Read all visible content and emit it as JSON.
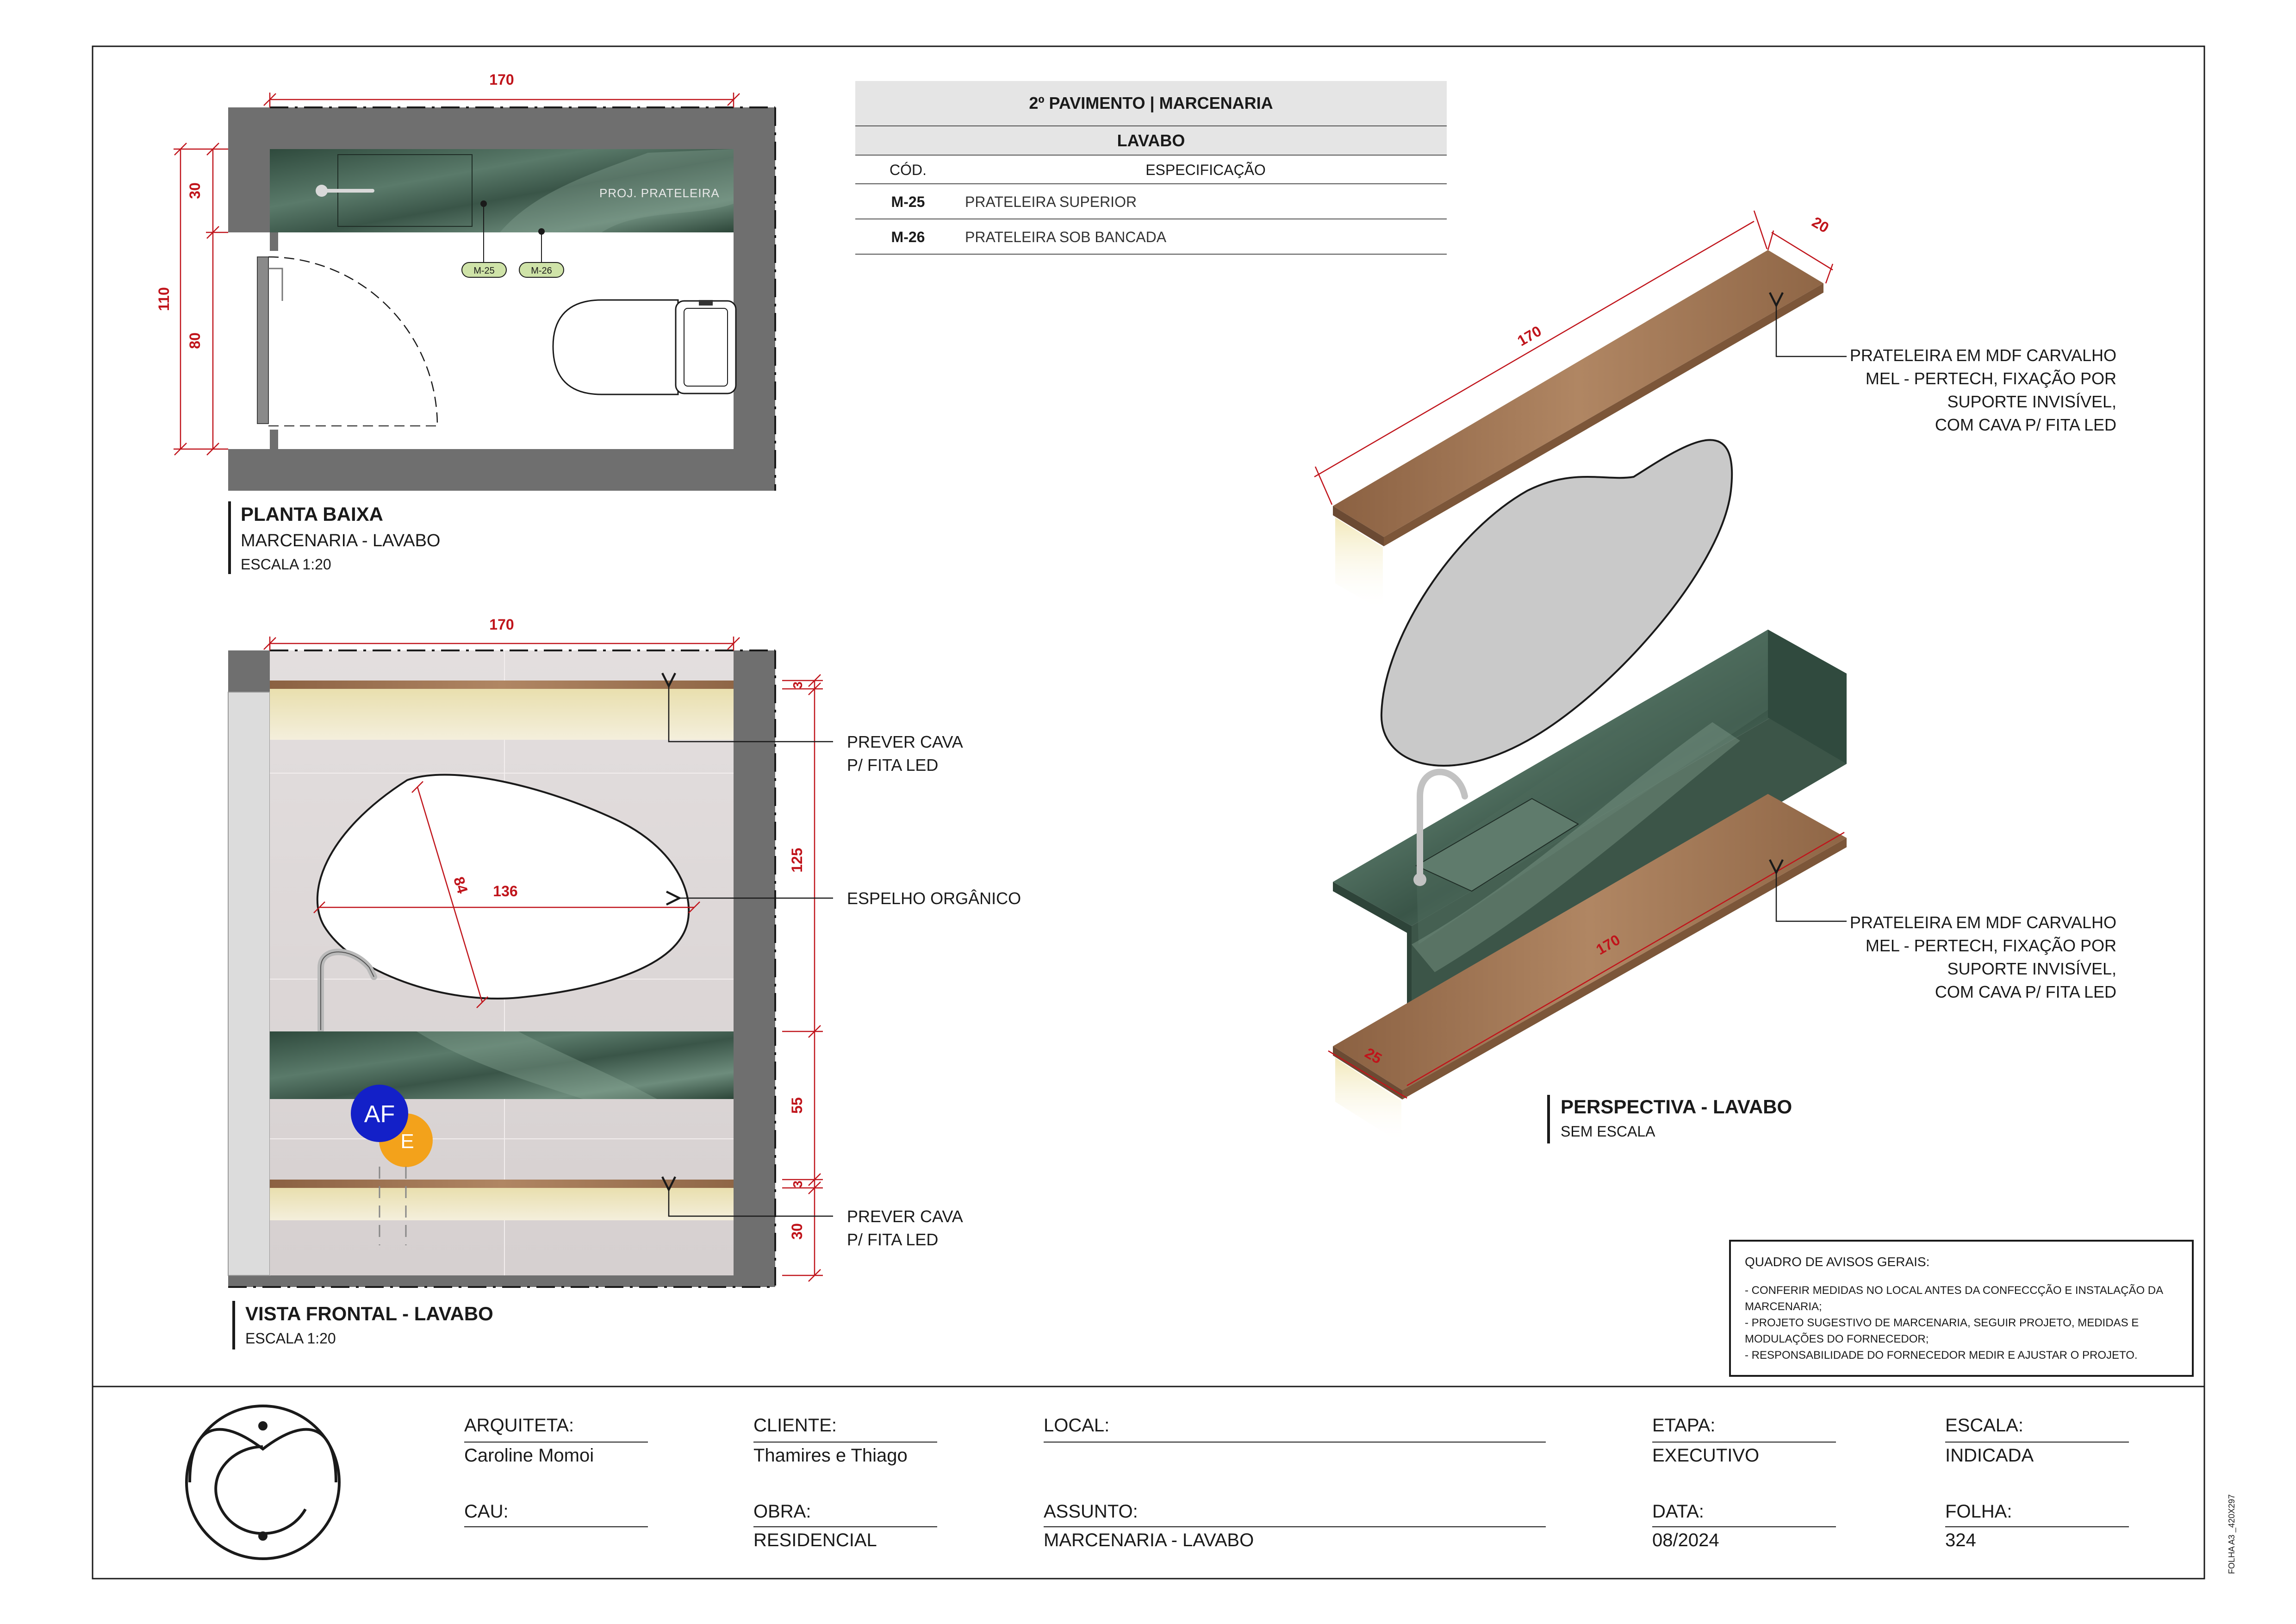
{
  "spec_table": {
    "title": "2º PAVIMENTO | MARCENARIA",
    "subtitle": "LAVABO",
    "col_code": "CÓD.",
    "col_spec": "ESPECIFICAÇÃO",
    "rows": [
      {
        "code": "M-25",
        "spec": "PRATELEIRA SUPERIOR"
      },
      {
        "code": "M-26",
        "spec": "PRATELEIRA SOB BANCADA"
      }
    ]
  },
  "plan": {
    "title": "PLANTA BAIXA",
    "subtitle": "MARCENARIA - LAVABO",
    "scale": "ESCALA 1:20",
    "dim_width": "170",
    "dim_total_height": "110",
    "dim_top": "30",
    "dim_bottom": "80",
    "shelf_note": "PROJ. PRATELEIRA",
    "tag_1": "M-25",
    "tag_2": "M-26"
  },
  "front": {
    "title": "VISTA FRONTAL - LAVABO",
    "scale": "ESCALA 1:20",
    "dim_width": "170",
    "dim_3a": "3",
    "dim_125": "125",
    "dim_55": "55",
    "dim_3b": "3",
    "dim_30": "30",
    "mirror_w": "136",
    "mirror_h": "84",
    "note_led_1a": "PREVER CAVA",
    "note_led_1b": "P/ FITA LED",
    "note_mirror": "ESPELHO ORGÂNICO",
    "note_led_2a": "PREVER CAVA",
    "note_led_2b": "P/ FITA LED",
    "point_af": "AF",
    "point_e": "E"
  },
  "perspective": {
    "title": "PERSPECTIVA - LAVABO",
    "scale": "SEM ESCALA",
    "dim_top_len": "170",
    "dim_top_depth": "20",
    "dim_bottom_len": "170",
    "dim_bottom_depth": "25",
    "note_top": [
      "PRATELEIRA EM MDF CARVALHO",
      "MEL - PERTECH, FIXAÇÃO POR",
      "SUPORTE INVISÍVEL,",
      "COM CAVA P/ FITA LED"
    ],
    "note_bottom": [
      "PRATELEIRA EM MDF CARVALHO",
      "MEL - PERTECH, FIXAÇÃO POR",
      "SUPORTE INVISÍVEL,",
      "COM CAVA P/ FITA LED"
    ]
  },
  "notices": {
    "title": "QUADRO DE AVISOS GERAIS:",
    "lines": [
      "- CONFERIR MEDIDAS NO LOCAL ANTES DA CONFECCÇÃO E INSTALAÇÃO DA",
      "MARCENARIA;",
      "- PROJETO SUGESTIVO DE MARCENARIA, SEGUIR PROJETO, MEDIDAS E",
      "MODULAÇÕES DO FORNECEDOR;",
      "- RESPONSABILIDADE DO FORNECEDOR MEDIR E AJUSTAR O PROJETO."
    ]
  },
  "title_block": {
    "arquiteta_label": "ARQUITETA:",
    "arquiteta_value": "Caroline Momoi",
    "cliente_label": "CLIENTE:",
    "cliente_value": "Thamires e Thiago",
    "local_label": "LOCAL:",
    "local_value": "",
    "etapa_label": "ETAPA:",
    "etapa_value": "EXECUTIVO",
    "escala_label": "ESCALA:",
    "escala_value": "INDICADA",
    "cau_label": "CAU:",
    "cau_value": "",
    "obra_label": "OBRA:",
    "obra_value": "RESIDENCIAL",
    "assunto_label": "ASSUNTO:",
    "assunto_value": "MARCENARIA - LAVABO",
    "data_label": "DATA:",
    "data_value": "08/2024",
    "folha_label": "FOLHA:",
    "folha_value": "324",
    "sheet_code": "FOLHA A3 _420X297"
  },
  "colors": {
    "dimension": "#c0141b",
    "wall": "#6f6f6f",
    "marble": "#3f5a4c",
    "wood": "#9c7352",
    "mirror": "#c9c9c9",
    "tag": "#cfe3a8",
    "af": "#1320c8",
    "e": "#f3a21b"
  }
}
